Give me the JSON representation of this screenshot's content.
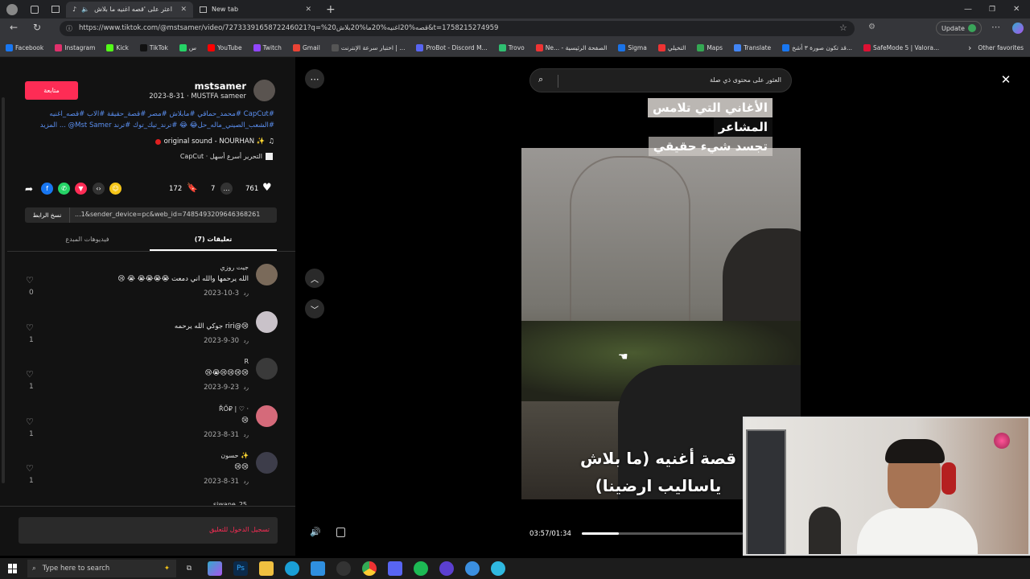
{
  "browser": {
    "tabs": [
      {
        "title": "اعثر على 'قصه اغنيه ما بلاش"
      },
      {
        "title": "New tab"
      }
    ],
    "url": "https://www.tiktok.com/@mstsamer/video/7273339165872246021?q=%20قصه%20اغنيه%20ما%20بلاش&t=1758215274959",
    "update_label": "Update",
    "bookmarks": [
      "Facebook",
      "Instagram",
      "Kick",
      "TikTok",
      "س",
      "YouTube",
      "Twitch",
      "Gmail",
      "اختبار سرعة الإنترنت | ...",
      "ProBot - Discord M...",
      "Trovo",
      "Ne... - الصفحة الرئيسية",
      "Sigma",
      "التخيلي",
      "Maps",
      "Translate",
      "قد تكون صورة ٣ أشخ...",
      "SafeMode 5 | Valora..."
    ],
    "other_favorites": "Other favorites"
  },
  "post": {
    "follow_label": "متابعة",
    "username": "mstsamer",
    "meta": "2023-8-31 · MUSTFA sameer",
    "caption_line1": "#CapCut #محمد_حماقي #مابلاش #مصر #قصة_حقيقة #الاب #قصه_اغنيه",
    "caption_line2": "#الشعب_الصيني_ماله_حل😂 😂 #ترند_تيك_توك #ترند Mst Samer@ ... المزيد",
    "sound": "original sound - NOURHAN ✨",
    "capcut": "CapCut · التحرير أسرع أسهل",
    "likes": "761",
    "comments_count": "7",
    "saves": "172",
    "link_text": "...1&sender_device=pc&web_id=7485493209646368261",
    "copy_link": "نسخ الرابط",
    "tab_comments": "تعليقات (7)",
    "tab_creator_videos": "فيديوهات المبدع",
    "login_prompt": "تسجيل الدخول للتعليق"
  },
  "comments": [
    {
      "name": "جيت روزي",
      "text": "الله يرحمها والله اني دمعت 😭😭😭😭 😭 😢",
      "date": "2023-10-3",
      "reply": "رد",
      "likes": "0",
      "avatar_color": "#7a6a5a"
    },
    {
      "name": "",
      "text": "😢@riri جوكي الله يرحمه",
      "date": "2023-9-30",
      "reply": "رد",
      "likes": "1",
      "avatar_color": "#c9c2c9"
    },
    {
      "name": "R",
      "text": "😢😢😢😢😭😢",
      "date": "2023-9-23",
      "reply": "رد",
      "likes": "1",
      "avatar_color": "#3a3a3a"
    },
    {
      "name": "ŘŐ₽ | ♡ ·",
      "text": "😢",
      "date": "2023-8-31",
      "reply": "رد",
      "likes": "1",
      "avatar_color": "#d56a7a"
    },
    {
      "name": "حسون ✨",
      "text": "😢😢",
      "date": "2023-8-31",
      "reply": "رد",
      "likes": "1",
      "avatar_color": "#3d3d4a"
    }
  ],
  "partial_comment_name": "siwane_25",
  "video": {
    "search_placeholder": "العثور على محتوى ذي صلة",
    "overlay_top": [
      "الأغاني التي تلامس",
      "المشاعر",
      "تجسد شيء حقيقي"
    ],
    "overlay_bottom": [
      "قصة أغنيه (ما بلاش",
      "ياساليب ارضينا)"
    ],
    "time": "03:57/01:34",
    "progress": 0.23
  },
  "taskbar": {
    "search_placeholder": "Type here to search"
  },
  "colors": {
    "accent": "#fe2c55",
    "hashtag": "#5b8ff0"
  }
}
